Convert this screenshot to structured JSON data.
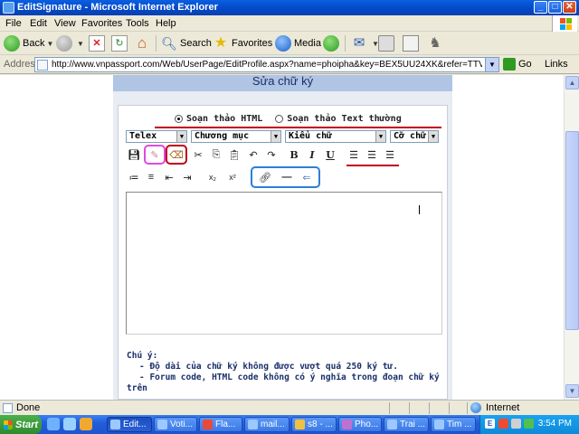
{
  "window": {
    "title": "EditSignature - Microsoft Internet Explorer",
    "minimize_label": "_",
    "maximize_label": "□",
    "close_label": "✕"
  },
  "menu": [
    "File",
    "Edit",
    "View",
    "Favorites",
    "Tools",
    "Help"
  ],
  "toolbar": {
    "back": "Back",
    "search": "Search",
    "favorites": "Favorites",
    "media": "Media"
  },
  "address": {
    "label": "Address",
    "url": "http://www.vnpassport.com/Web/UserPage/EditProfile.aspx?name=phoipha&key=BEX5UU24XK&refer=TTVNOL",
    "go": "Go",
    "links": "Links"
  },
  "page": {
    "heading": "Sửa chữ ký",
    "radio_html": "Soạn thảo HTML",
    "radio_text": "Soạn thảo Text thường",
    "radio_html_selected": true,
    "selects": {
      "input_method": "Telex",
      "category": "Chương mục",
      "font_style": "Kiểu chữ",
      "font_size": "Cỡ chữ"
    },
    "notes": {
      "title": "Chú ý:",
      "line1": "- Độ dài của chữ ký không được vượt quá 250 ký tư.",
      "line2": "- Forum code, HTML code không có ý nghĩa trong đoạn chữ ký",
      "line3": "trên"
    }
  },
  "status": {
    "text": "Done",
    "zone": "Internet"
  },
  "taskbar": {
    "start": "Start",
    "tasks": [
      "Edit...",
      "Voti...",
      "Fla...",
      "mail...",
      "s8 - ...",
      "Pho...",
      "Trai ...",
      "Tim ..."
    ],
    "clock": "3:54 PM"
  },
  "colors": {
    "title_blue": "#0348c6",
    "header_band": "#b0c4e4",
    "content_bg": "#e8ecf3",
    "highlight_red": "#c00018",
    "highlight_pink": "#e04adf",
    "highlight_blue": "#2c7fd8"
  }
}
